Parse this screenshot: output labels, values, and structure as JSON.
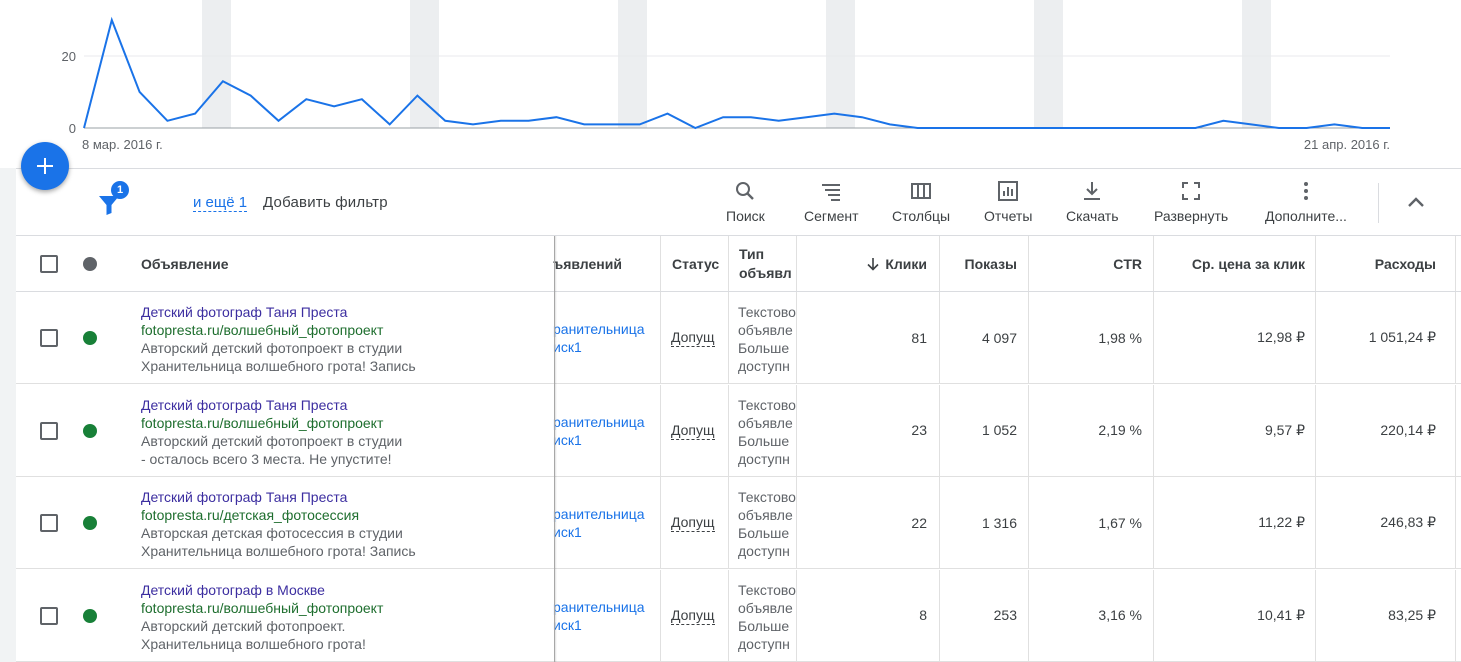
{
  "chart": {
    "y_ticks": [
      "20",
      "0"
    ],
    "x_start_label": "8 мар. 2016 г.",
    "x_end_label": "21 апр. 2016 г.",
    "line_color": "#1a73e8",
    "values": [
      0,
      30,
      10,
      2,
      4,
      13,
      9,
      2,
      8,
      6,
      8,
      1,
      9,
      2,
      1,
      2,
      2,
      3,
      1,
      1,
      1,
      4,
      0,
      3,
      3,
      2,
      3,
      4,
      3,
      1,
      0,
      0,
      0,
      0,
      0,
      0,
      0,
      0,
      0,
      0,
      0,
      2,
      1,
      0,
      0,
      1,
      0,
      0
    ]
  },
  "toolbar": {
    "filter_count": "1",
    "more_filters": "и ещё 1",
    "add_filter": "Добавить фильтр",
    "tools": [
      {
        "name": "search",
        "label": "Поиск"
      },
      {
        "name": "segment",
        "label": "Сегмент"
      },
      {
        "name": "columns",
        "label": "Столбцы"
      },
      {
        "name": "reports",
        "label": "Отчеты"
      },
      {
        "name": "download",
        "label": "Скачать"
      },
      {
        "name": "expand",
        "label": "Развернуть"
      },
      {
        "name": "more",
        "label": "Дополните..."
      }
    ]
  },
  "table": {
    "headers": {
      "ad": "Объявление",
      "group": "ъявлений",
      "status": "Статус",
      "type_line1": "Тип",
      "type_line2": "объявл",
      "clicks": "Клики",
      "impressions": "Показы",
      "ctr": "CTR",
      "cpc": "Ср. цена за клик",
      "cost": "Расходы"
    },
    "rows": [
      {
        "title": "Детский фотограф Таня Преста",
        "url": "fotopresta.ru/волшебный_фотопроект",
        "desc1": "Авторский детский фотопроект в студии",
        "desc2": "Хранительница волшебного грота! Запись",
        "group1": "ранительница",
        "group2": "иск1",
        "status": "Допущ",
        "type1": "Текстово",
        "type2": "объявле",
        "type3": "Больше",
        "type4": "доступн",
        "clicks": "81",
        "impressions": "4 097",
        "ctr": "1,98 %",
        "cpc": "12,98 ₽",
        "cost": "1 051,24 ₽"
      },
      {
        "title": "Детский фотограф Таня Преста",
        "url": "fotopresta.ru/волшебный_фотопроект",
        "desc1": "Авторский детский фотопроект в студии",
        "desc2": "- осталось всего 3 места. Не упустите!",
        "group1": "ранительница",
        "group2": "иск1",
        "status": "Допущ",
        "type1": "Текстово",
        "type2": "объявле",
        "type3": "Больше",
        "type4": "доступн",
        "clicks": "23",
        "impressions": "1 052",
        "ctr": "2,19 %",
        "cpc": "9,57 ₽",
        "cost": "220,14 ₽"
      },
      {
        "title": "Детский фотограф Таня Преста",
        "url": "fotopresta.ru/детская_фотосессия",
        "desc1": "Авторская детская фотосессия в студии",
        "desc2": "Хранительница волшебного грота! Запись",
        "group1": "ранительница",
        "group2": "иск1",
        "status": "Допущ",
        "type1": "Текстово",
        "type2": "объявле",
        "type3": "Больше",
        "type4": "доступн",
        "clicks": "22",
        "impressions": "1 316",
        "ctr": "1,67 %",
        "cpc": "11,22 ₽",
        "cost": "246,83 ₽"
      },
      {
        "title": "Детский фотограф в Москве",
        "url": "fotopresta.ru/волшебный_фотопроект",
        "desc1": "Авторский детский фотопроект.",
        "desc2": "Хранительница волшебного грота!",
        "group1": "ранительница",
        "group2": "иск1",
        "status": "Допущ",
        "type1": "Текстово",
        "type2": "объявле",
        "type3": "Больше",
        "type4": "доступн",
        "clicks": "8",
        "impressions": "253",
        "ctr": "3,16 %",
        "cpc": "10,41 ₽",
        "cost": "83,25 ₽"
      }
    ]
  },
  "colors": {
    "accent": "#1a73e8",
    "status_enabled": "#188038",
    "status_header": "#5f6368"
  }
}
